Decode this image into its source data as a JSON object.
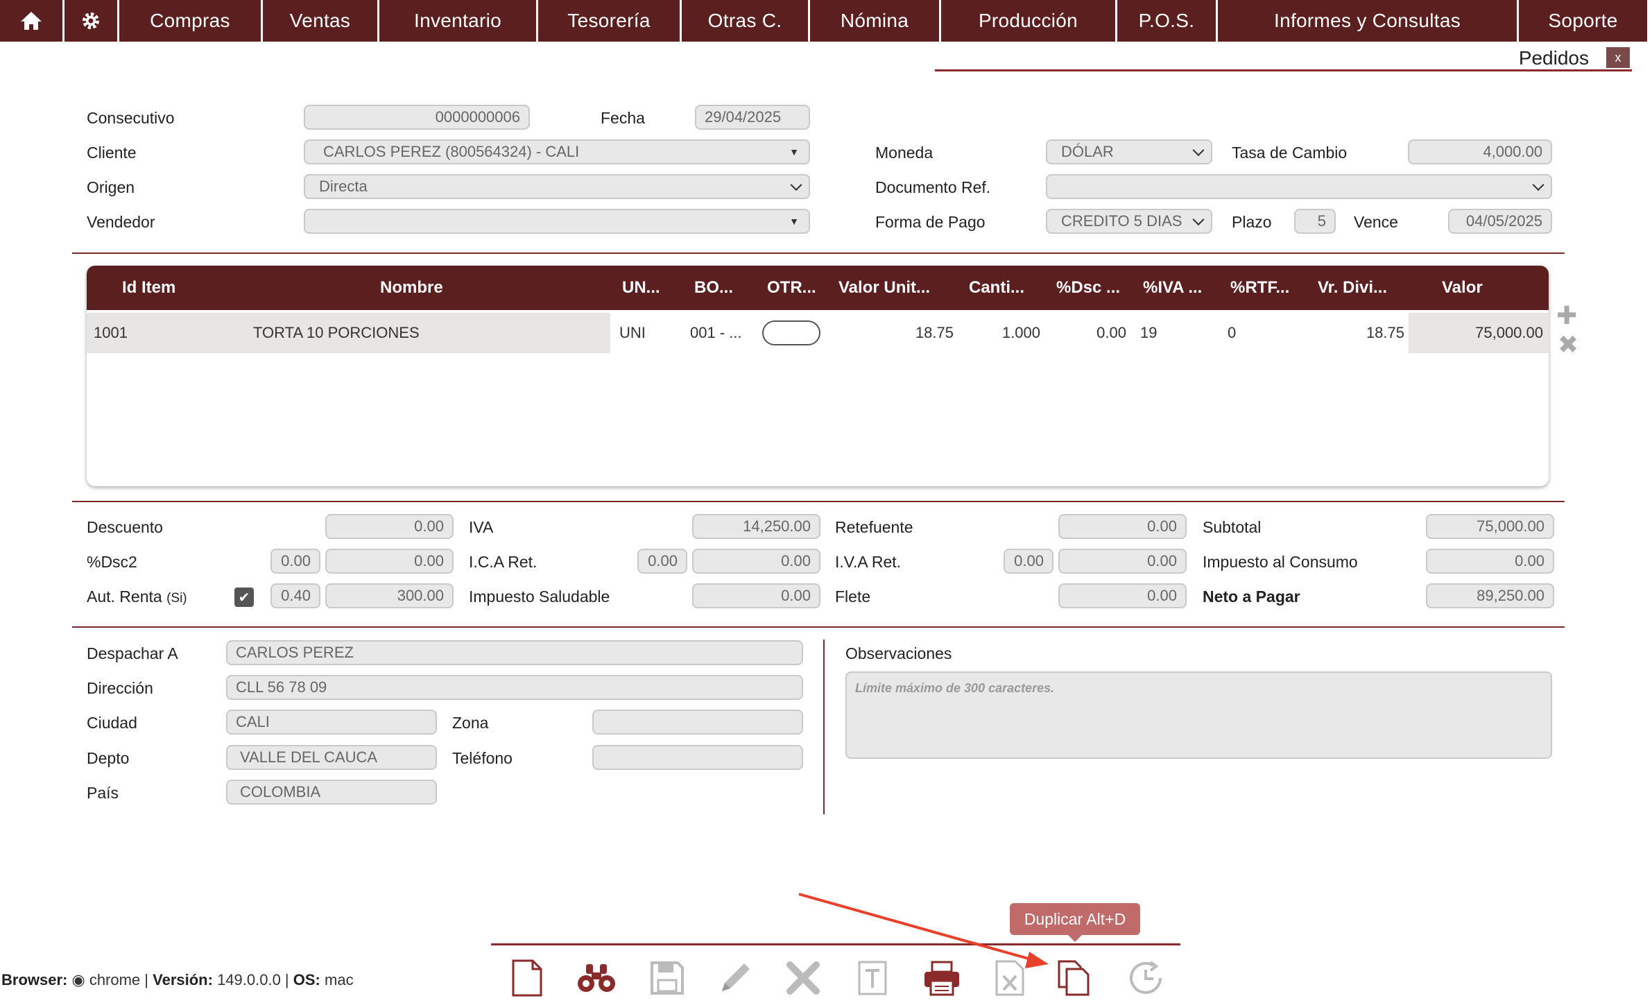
{
  "nav": {
    "items": [
      "Compras",
      "Ventas",
      "Inventario",
      "Tesorería",
      "Otras C.",
      "Nómina",
      "Producción",
      "P.O.S.",
      "Informes y Consultas",
      "Soporte"
    ]
  },
  "module": {
    "title": "Pedidos",
    "close": "x"
  },
  "header": {
    "consecutivo_label": "Consecutivo",
    "consecutivo": "0000000006",
    "fecha_label": "Fecha",
    "fecha": "29/04/2025",
    "cliente_label": "Cliente",
    "cliente": "CARLOS PEREZ (800564324) - CALI",
    "origen_label": "Origen",
    "origen": "Directa",
    "vendedor_label": "Vendedor",
    "vendedor": "",
    "moneda_label": "Moneda",
    "moneda": "DÓLAR",
    "tasa_label": "Tasa de Cambio",
    "tasa": "4,000.00",
    "docref_label": "Documento Ref.",
    "docref": "",
    "formapago_label": "Forma de Pago",
    "formapago": "CREDITO 5 DIAS",
    "plazo_label": "Plazo",
    "plazo": "5",
    "vence_label": "Vence",
    "vence": "04/05/2025"
  },
  "grid": {
    "columns": [
      "Id Item",
      "Nombre",
      "UN...",
      "BO...",
      "OTR...",
      "Valor Unit...",
      "Canti...",
      "%Dsc ...",
      "%IVA ...",
      "%RTF...",
      "Vr. Divi...",
      "Valor"
    ],
    "rows": [
      {
        "id": "1001",
        "nombre": "TORTA 10 PORCIONES",
        "un": "UNI",
        "bo": "001 - ...",
        "valor_unit": "18.75",
        "cantidad": "1.000",
        "dsc": "0.00",
        "iva": "19",
        "rtf": "0",
        "vr_divi": "18.75",
        "valor": "75,000.00"
      }
    ]
  },
  "totals": {
    "descuento_label": "Descuento",
    "descuento": "0.00",
    "dsc2_label": "%Dsc2",
    "dsc2_pct": "0.00",
    "dsc2": "0.00",
    "autrenta_label": "Aut. Renta",
    "autrenta_suffix": "(Si)",
    "autrenta_pct": "0.40",
    "autrenta": "300.00",
    "iva_label": "IVA",
    "iva": "14,250.00",
    "ica_label": "I.C.A Ret.",
    "ica_pct": "0.00",
    "ica": "0.00",
    "saludable_label": "Impuesto Saludable",
    "saludable": "0.00",
    "retefuente_label": "Retefuente",
    "retefuente": "0.00",
    "ivaret_label": "I.V.A Ret.",
    "ivaret_pct": "0.00",
    "ivaret": "0.00",
    "flete_label": "Flete",
    "flete": "0.00",
    "subtotal_label": "Subtotal",
    "subtotal": "75,000.00",
    "consumo_label": "Impuesto al Consumo",
    "consumo": "0.00",
    "neto_label": "Neto a Pagar",
    "neto": "89,250.00"
  },
  "shipping": {
    "despachar_label": "Despachar A",
    "despachar": "CARLOS  PEREZ",
    "direccion_label": "Dirección",
    "direccion": "CLL 56 78 09",
    "ciudad_label": "Ciudad",
    "ciudad": "CALI",
    "zona_label": "Zona",
    "zona": "",
    "depto_label": "Depto",
    "depto": "VALLE DEL CAUCA",
    "telefono_label": "Teléfono",
    "telefono": "",
    "pais_label": "País",
    "pais": "COLOMBIA",
    "obs_label": "Observaciones",
    "obs_placeholder": "Límite máximo de 300 caracteres."
  },
  "toolbar": {
    "tooltip": "Duplicar Alt+D"
  },
  "footer": {
    "browser_label": "Browser:",
    "browser": "chrome",
    "version_label": "Versión:",
    "version": "149.0.0.0",
    "os_label": "OS:",
    "os": "mac"
  },
  "colors": {
    "primary": "#5c1f1f",
    "accent": "#c06a6a",
    "arrow": "#e8402a"
  }
}
